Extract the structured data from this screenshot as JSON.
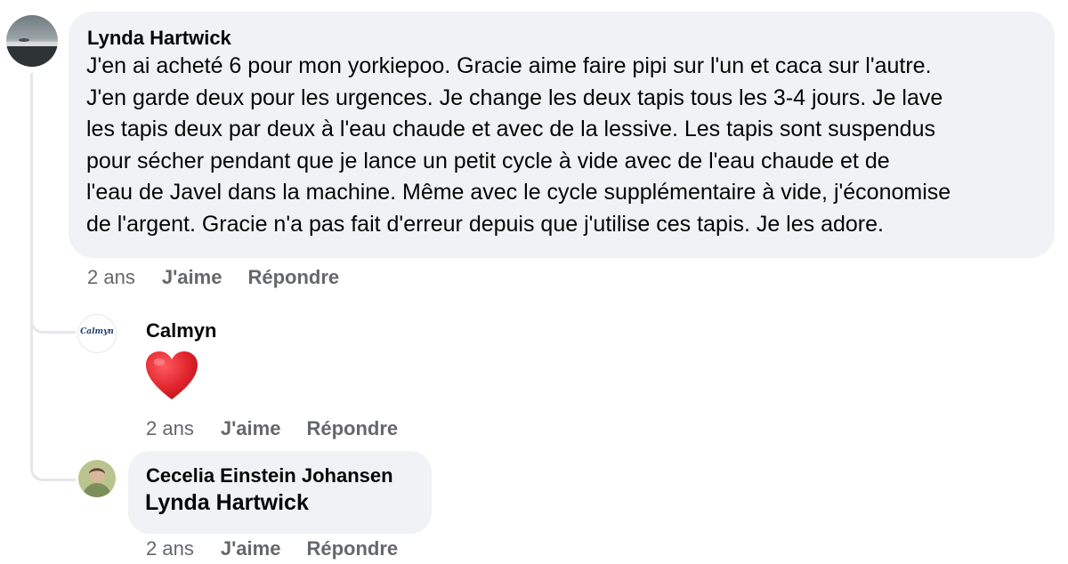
{
  "comments": [
    {
      "author": "Lynda Hartwick",
      "lines": [
        "J'en ai acheté 6 pour mon yorkiepoo. Gracie aime faire pipi sur l'un et caca sur l'autre.",
        "J'en garde deux pour les urgences. Je change les deux tapis tous les 3-4 jours. Je lave",
        "les tapis deux par deux à l'eau chaude et avec de la lessive. Les tapis sont suspendus",
        "pour sécher pendant que je lance un petit cycle à vide avec de l'eau chaude et de",
        "l'eau de Javel dans la machine. Même avec le cycle supplémentaire à vide, j'économise",
        "de l'argent. Gracie n'a pas fait d'erreur depuis que j'utilise ces tapis. Je les adore."
      ],
      "time": "2 ans",
      "like_label": "J'aime",
      "reply_label": "Répondre"
    }
  ],
  "replies": [
    {
      "author": "Calmyn",
      "avatar_text": "Calmyn",
      "content_icon": "red-heart-emoji",
      "time": "2 ans",
      "like_label": "J'aime",
      "reply_label": "Répondre"
    },
    {
      "author": "Cecelia Einstein Johansen",
      "mention": "Lynda Hartwick",
      "time": "2 ans",
      "like_label": "J'aime",
      "reply_label": "Répondre"
    }
  ],
  "colors": {
    "bubble": "#f0f2f5",
    "text": "#050505",
    "meta": "#65676b",
    "heart": "#e0242c",
    "thread_line": "#e4e6eb"
  }
}
